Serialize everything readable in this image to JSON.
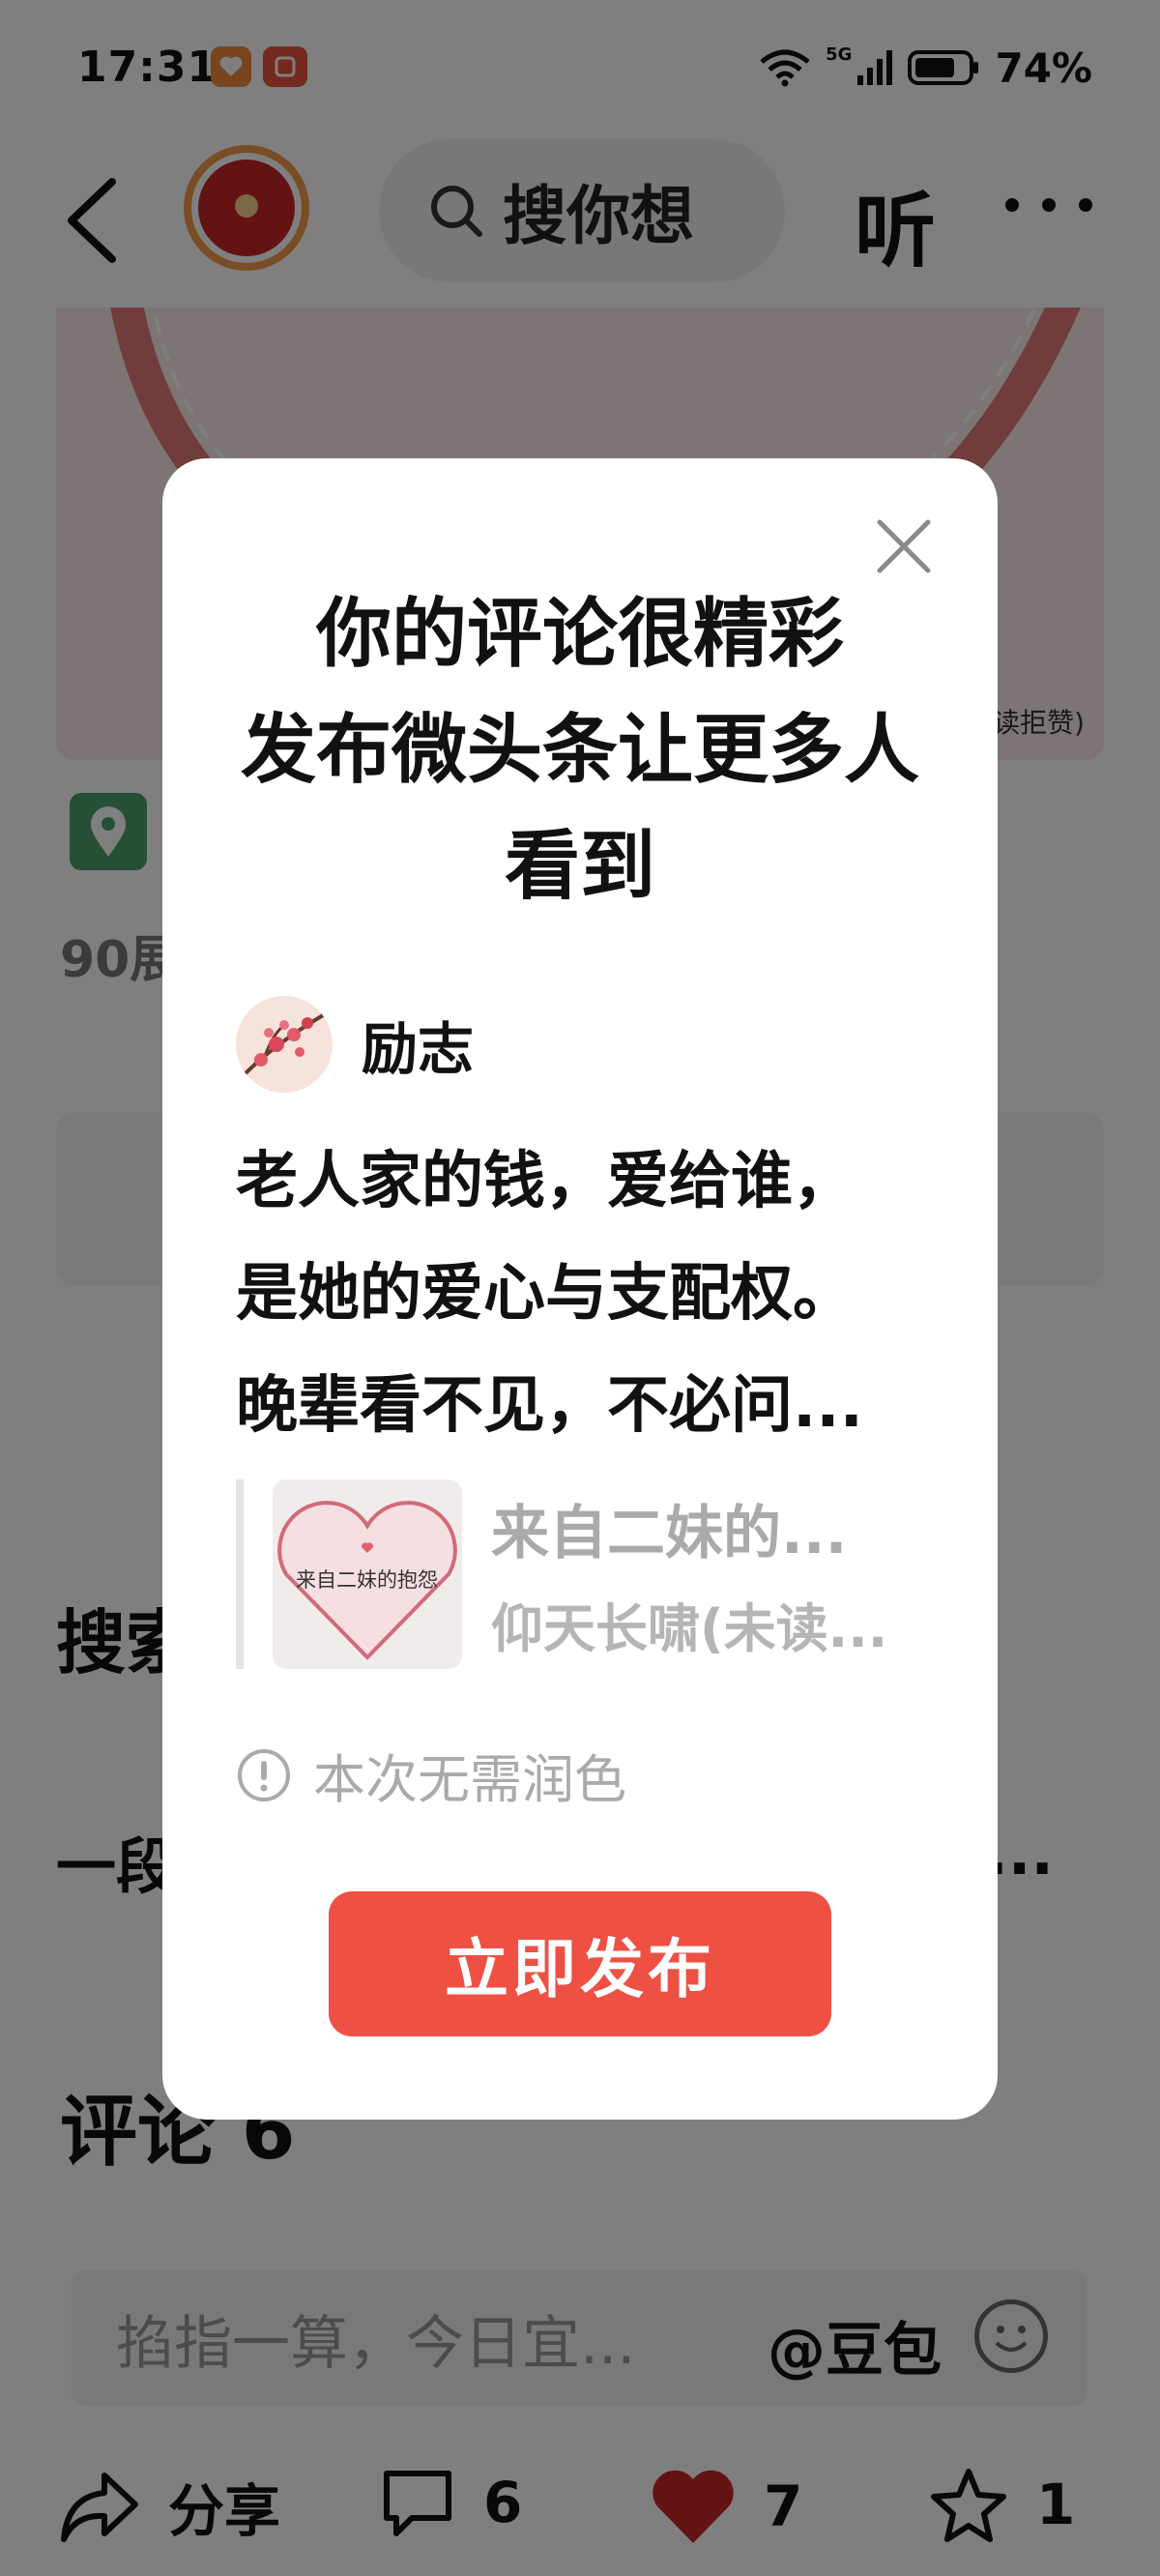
{
  "status_bar": {
    "time": "17:31",
    "network": "5G",
    "battery": "74%"
  },
  "nav": {
    "search_text": "搜你想",
    "listen_label": "听"
  },
  "article": {
    "read_count": "90展",
    "search_section": "搜索",
    "text_line": "一段",
    "text_tail": "...",
    "comments_title": "评论 6"
  },
  "comment_box": {
    "placeholder": "掐指一算，今日宜...",
    "mention": "@豆包"
  },
  "bottom_bar": {
    "share_label": "分享",
    "comment_count": "6",
    "like_count": "7",
    "favorite_count": "1"
  },
  "modal": {
    "title_lines": [
      "你的评论很精彩",
      "发布微头条让更多人",
      "看到"
    ],
    "author_name": "励志",
    "body_lines": [
      "老人家的钱，爱给谁，",
      "是她的爱心与支配权。",
      "晚辈看不见，不必问..."
    ],
    "quote_thumb_text": "来自二妹的抱怨",
    "quote_title": "来自二妹的...",
    "quote_subtitle": "仰天长啸(未读...",
    "hint": "本次无需润色",
    "publish_label": "立即发布"
  },
  "colors": {
    "accent": "#ee5044",
    "like_red": "#c8262b",
    "overlay": "rgba(0,0,0,0.5)"
  }
}
